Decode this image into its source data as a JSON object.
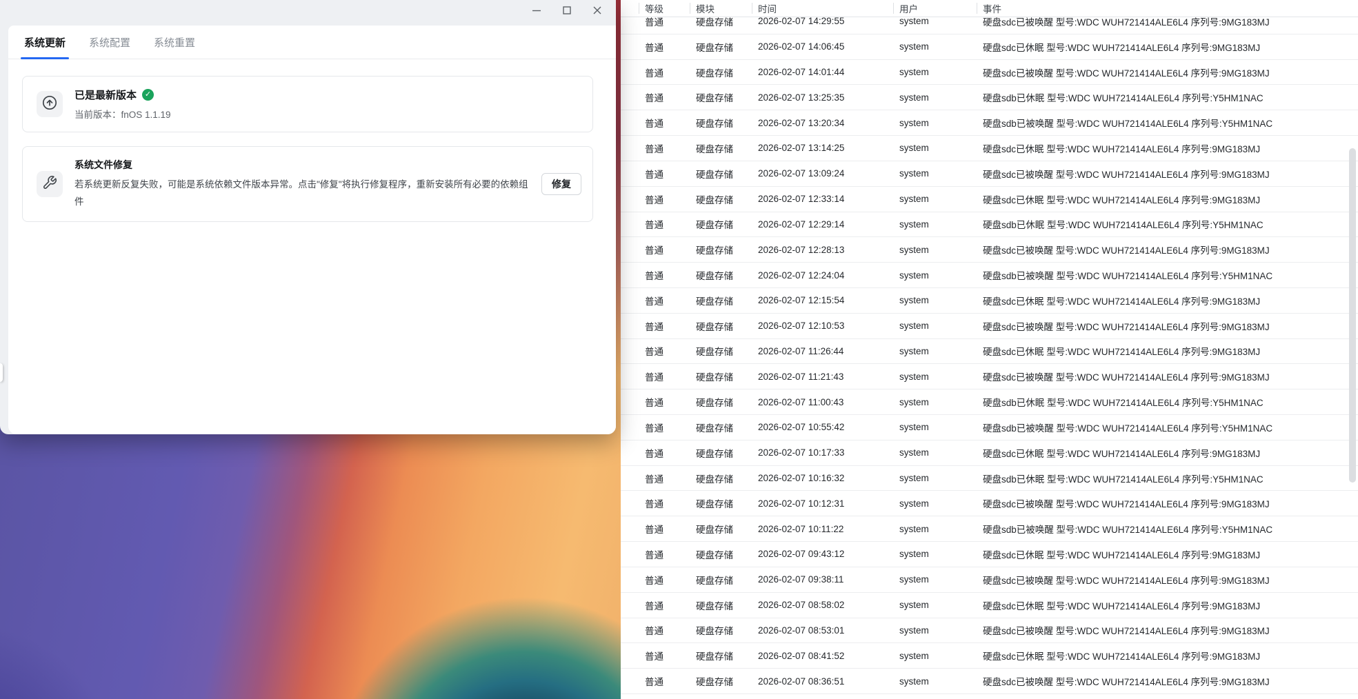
{
  "colors": {
    "accent_blue": "#2468f2",
    "success_green": "#1ba35c",
    "window_chrome": "#eef0f3"
  },
  "window": {
    "tabs": [
      {
        "label": "系统更新",
        "active": true
      },
      {
        "label": "系统配置",
        "active": false
      },
      {
        "label": "系统重置",
        "active": false
      }
    ],
    "update_card": {
      "title": "已是最新版本",
      "badge_icon": "check",
      "version_line": "当前版本：fnOS 1.1.19"
    },
    "repair_card": {
      "title": "系统文件修复",
      "description": "若系统更新反复失败，可能是系统依赖文件版本异常。点击\"修复\"将执行修复程序，重新安装所有必要的依赖组件",
      "button_label": "修复"
    }
  },
  "log_table": {
    "columns": [
      "等级",
      "模块",
      "时间",
      "用户",
      "事件"
    ],
    "rows": [
      {
        "level": "普通",
        "module": "硬盘存储",
        "time": "2026-02-07 14:29:55",
        "user": "system",
        "event": "硬盘sdc已被唤醒 型号:WDC WUH721414ALE6L4 序列号:9MG183MJ"
      },
      {
        "level": "普通",
        "module": "硬盘存储",
        "time": "2026-02-07 14:06:45",
        "user": "system",
        "event": "硬盘sdc已休眠 型号:WDC WUH721414ALE6L4 序列号:9MG183MJ"
      },
      {
        "level": "普通",
        "module": "硬盘存储",
        "time": "2026-02-07 14:01:44",
        "user": "system",
        "event": "硬盘sdc已被唤醒 型号:WDC WUH721414ALE6L4 序列号:9MG183MJ"
      },
      {
        "level": "普通",
        "module": "硬盘存储",
        "time": "2026-02-07 13:25:35",
        "user": "system",
        "event": "硬盘sdb已休眠 型号:WDC WUH721414ALE6L4 序列号:Y5HM1NAC"
      },
      {
        "level": "普通",
        "module": "硬盘存储",
        "time": "2026-02-07 13:20:34",
        "user": "system",
        "event": "硬盘sdb已被唤醒 型号:WDC WUH721414ALE6L4 序列号:Y5HM1NAC"
      },
      {
        "level": "普通",
        "module": "硬盘存储",
        "time": "2026-02-07 13:14:25",
        "user": "system",
        "event": "硬盘sdc已休眠 型号:WDC WUH721414ALE6L4 序列号:9MG183MJ"
      },
      {
        "level": "普通",
        "module": "硬盘存储",
        "time": "2026-02-07 13:09:24",
        "user": "system",
        "event": "硬盘sdc已被唤醒 型号:WDC WUH721414ALE6L4 序列号:9MG183MJ"
      },
      {
        "level": "普通",
        "module": "硬盘存储",
        "time": "2026-02-07 12:33:14",
        "user": "system",
        "event": "硬盘sdc已休眠 型号:WDC WUH721414ALE6L4 序列号:9MG183MJ"
      },
      {
        "level": "普通",
        "module": "硬盘存储",
        "time": "2026-02-07 12:29:14",
        "user": "system",
        "event": "硬盘sdb已休眠 型号:WDC WUH721414ALE6L4 序列号:Y5HM1NAC"
      },
      {
        "level": "普通",
        "module": "硬盘存储",
        "time": "2026-02-07 12:28:13",
        "user": "system",
        "event": "硬盘sdc已被唤醒 型号:WDC WUH721414ALE6L4 序列号:9MG183MJ"
      },
      {
        "level": "普通",
        "module": "硬盘存储",
        "time": "2026-02-07 12:24:04",
        "user": "system",
        "event": "硬盘sdb已被唤醒 型号:WDC WUH721414ALE6L4 序列号:Y5HM1NAC"
      },
      {
        "level": "普通",
        "module": "硬盘存储",
        "time": "2026-02-07 12:15:54",
        "user": "system",
        "event": "硬盘sdc已休眠 型号:WDC WUH721414ALE6L4 序列号:9MG183MJ"
      },
      {
        "level": "普通",
        "module": "硬盘存储",
        "time": "2026-02-07 12:10:53",
        "user": "system",
        "event": "硬盘sdc已被唤醒 型号:WDC WUH721414ALE6L4 序列号:9MG183MJ"
      },
      {
        "level": "普通",
        "module": "硬盘存储",
        "time": "2026-02-07 11:26:44",
        "user": "system",
        "event": "硬盘sdc已休眠 型号:WDC WUH721414ALE6L4 序列号:9MG183MJ"
      },
      {
        "level": "普通",
        "module": "硬盘存储",
        "time": "2026-02-07 11:21:43",
        "user": "system",
        "event": "硬盘sdc已被唤醒 型号:WDC WUH721414ALE6L4 序列号:9MG183MJ"
      },
      {
        "level": "普通",
        "module": "硬盘存储",
        "time": "2026-02-07 11:00:43",
        "user": "system",
        "event": "硬盘sdb已休眠 型号:WDC WUH721414ALE6L4 序列号:Y5HM1NAC"
      },
      {
        "level": "普通",
        "module": "硬盘存储",
        "time": "2026-02-07 10:55:42",
        "user": "system",
        "event": "硬盘sdb已被唤醒 型号:WDC WUH721414ALE6L4 序列号:Y5HM1NAC"
      },
      {
        "level": "普通",
        "module": "硬盘存储",
        "time": "2026-02-07 10:17:33",
        "user": "system",
        "event": "硬盘sdc已休眠 型号:WDC WUH721414ALE6L4 序列号:9MG183MJ"
      },
      {
        "level": "普通",
        "module": "硬盘存储",
        "time": "2026-02-07 10:16:32",
        "user": "system",
        "event": "硬盘sdb已休眠 型号:WDC WUH721414ALE6L4 序列号:Y5HM1NAC"
      },
      {
        "level": "普通",
        "module": "硬盘存储",
        "time": "2026-02-07 10:12:31",
        "user": "system",
        "event": "硬盘sdc已被唤醒 型号:WDC WUH721414ALE6L4 序列号:9MG183MJ"
      },
      {
        "level": "普通",
        "module": "硬盘存储",
        "time": "2026-02-07 10:11:22",
        "user": "system",
        "event": "硬盘sdb已被唤醒 型号:WDC WUH721414ALE6L4 序列号:Y5HM1NAC"
      },
      {
        "level": "普通",
        "module": "硬盘存储",
        "time": "2026-02-07 09:43:12",
        "user": "system",
        "event": "硬盘sdc已休眠 型号:WDC WUH721414ALE6L4 序列号:9MG183MJ"
      },
      {
        "level": "普通",
        "module": "硬盘存储",
        "time": "2026-02-07 09:38:11",
        "user": "system",
        "event": "硬盘sdc已被唤醒 型号:WDC WUH721414ALE6L4 序列号:9MG183MJ"
      },
      {
        "level": "普通",
        "module": "硬盘存储",
        "time": "2026-02-07 08:58:02",
        "user": "system",
        "event": "硬盘sdc已休眠 型号:WDC WUH721414ALE6L4 序列号:9MG183MJ"
      },
      {
        "level": "普通",
        "module": "硬盘存储",
        "time": "2026-02-07 08:53:01",
        "user": "system",
        "event": "硬盘sdc已被唤醒 型号:WDC WUH721414ALE6L4 序列号:9MG183MJ"
      },
      {
        "level": "普通",
        "module": "硬盘存储",
        "time": "2026-02-07 08:41:52",
        "user": "system",
        "event": "硬盘sdc已休眠 型号:WDC WUH721414ALE6L4 序列号:9MG183MJ"
      },
      {
        "level": "普通",
        "module": "硬盘存储",
        "time": "2026-02-07 08:36:51",
        "user": "system",
        "event": "硬盘sdc已被唤醒 型号:WDC WUH721414ALE6L4 序列号:9MG183MJ"
      }
    ]
  }
}
